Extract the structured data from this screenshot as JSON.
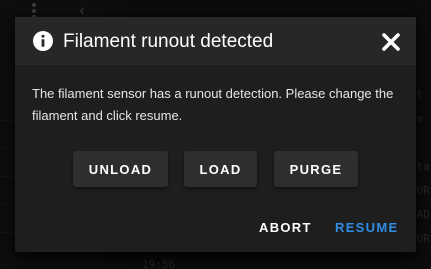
{
  "background": {
    "ghost_lines": [
      "t",
      "me",
      "sta",
      "|UR",
      "DAD",
      "PUR",
      "19:56"
    ]
  },
  "dialog": {
    "title": "Filament runout detected",
    "title_icon": "info-icon",
    "close_icon": "close-icon",
    "message": "The filament sensor has a runout detection. Please change the filament and click resume.",
    "actions": {
      "unload": "UNLOAD",
      "load": "LOAD",
      "purge": "PURGE"
    },
    "footer": {
      "abort": "ABORT",
      "resume": "RESUME"
    }
  },
  "colors": {
    "dialog_bg": "#1e1e1e",
    "header_bg": "#272727",
    "button_bg": "#2e2e2e",
    "accent": "#2f8de4",
    "text": "#ffffff"
  }
}
